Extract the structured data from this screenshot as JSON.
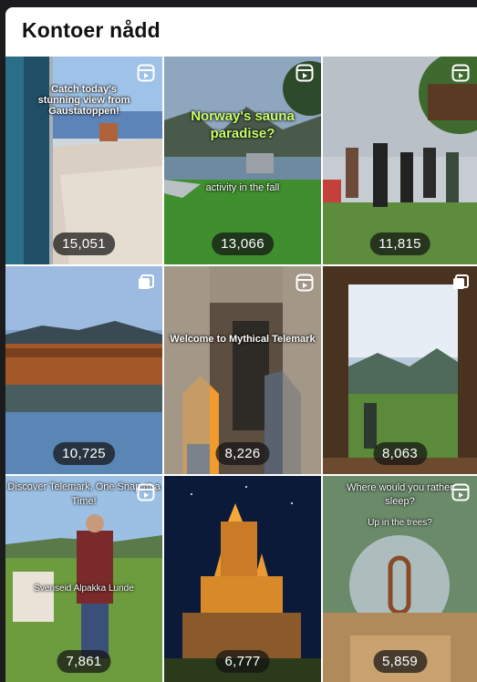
{
  "header": {
    "title": "Kontoer nådd"
  },
  "tiles": [
    {
      "count": "15,051",
      "caption": "Catch today's stunning view from Gaustatoppen!",
      "caption2": "",
      "icon": "reel-icon"
    },
    {
      "count": "13,066",
      "caption": "Norway's sauna paradise?",
      "caption2": "activity in the fall",
      "icon": "reel-icon"
    },
    {
      "count": "11,815",
      "caption": "",
      "caption2": "",
      "icon": "reel-icon"
    },
    {
      "count": "10,725",
      "caption": "",
      "caption2": "",
      "icon": "carousel-icon"
    },
    {
      "count": "8,226",
      "caption": "Welcome to Mythical Telemark",
      "caption2": "",
      "icon": "reel-icon"
    },
    {
      "count": "8,063",
      "caption": "",
      "caption2": "",
      "icon": "carousel-icon"
    },
    {
      "count": "7,861",
      "caption": "Discover Telemark, One Snap at a Time!",
      "caption2": "Svenseid Alpakka Lunde",
      "icon": "reel-icon"
    },
    {
      "count": "6,777",
      "caption": "",
      "caption2": "",
      "icon": "none"
    },
    {
      "count": "5,859",
      "caption": "Where would you rather sleep?",
      "caption2": "Up in the trees?",
      "icon": "reel-icon"
    }
  ]
}
